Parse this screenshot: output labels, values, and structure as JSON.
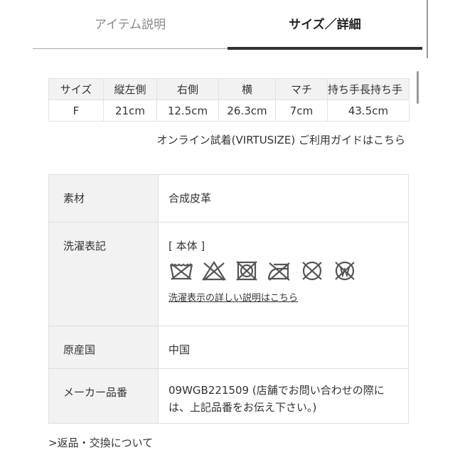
{
  "tabs": [
    {
      "label": "アイテム説明",
      "active": false
    },
    {
      "label": "サイズ／詳細",
      "active": true
    }
  ],
  "size_table": {
    "headers": [
      "サイズ",
      "縦左側",
      "右側",
      "横",
      "マチ",
      "持ち手長持ち手"
    ],
    "rows": [
      [
        "F",
        "21cm",
        "12.5cm",
        "26.3cm",
        "7cm",
        "43.5cm"
      ]
    ]
  },
  "virtusize_link": "オンライン試着(VIRTUSIZE) ご利用ガイドはこちら",
  "details": {
    "material": {
      "label": "素材",
      "value": "合成皮革"
    },
    "care": {
      "label": "洗濯表記",
      "part": "[ 本体 ]",
      "icons": [
        "no-wash-icon",
        "no-bleach-icon",
        "no-tumble-dry-icon",
        "no-iron-icon",
        "no-dry-clean-icon",
        "no-wet-clean-icon"
      ],
      "link": "洗濯表示の詳しい説明はこちら"
    },
    "origin": {
      "label": "原産国",
      "value": "中国"
    },
    "maker_code": {
      "label": "メーカー品番",
      "value": "09WGB221509 (店舗でお問い合わせの際には、上記品番をお伝え下さい。)"
    }
  },
  "footer_link": ">返品・交換について",
  "colors": {
    "icon": "#555555",
    "label_bg": "#f2f2f2",
    "active_tab_line": "#333333"
  }
}
